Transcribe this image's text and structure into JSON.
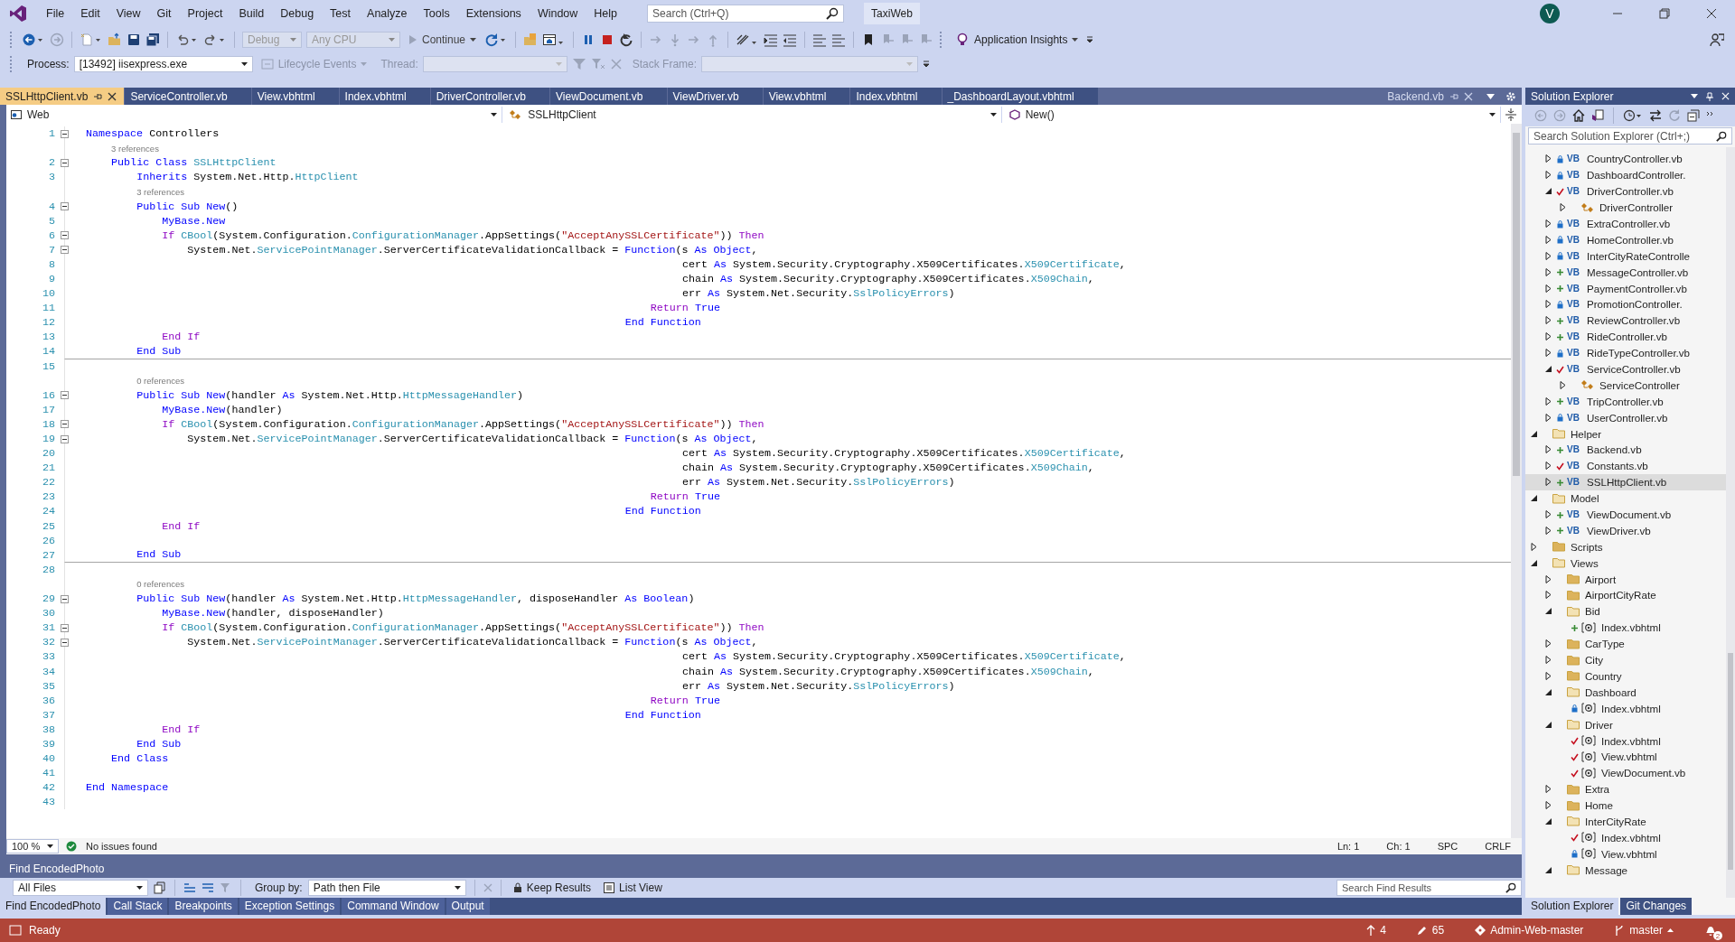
{
  "window": {
    "title": "TaxiWeb",
    "avatar": "V"
  },
  "menu": [
    "File",
    "Edit",
    "View",
    "Git",
    "Project",
    "Build",
    "Debug",
    "Test",
    "Analyze",
    "Tools",
    "Extensions",
    "Window",
    "Help"
  ],
  "search": {
    "placeholder": "Search (Ctrl+Q)"
  },
  "toolbar": {
    "configuration": {
      "label": "Debug",
      "disabled": true
    },
    "platform": {
      "label": "Any CPU",
      "disabled": true
    },
    "continue": "Continue",
    "insights": "Application Insights"
  },
  "debug_bar": {
    "process_label": "Process:",
    "process": "[13492] iisexpress.exe",
    "lifecycle": {
      "label": "Lifecycle Events",
      "disabled": true
    },
    "thread": {
      "label": "Thread:",
      "disabled": true
    },
    "stack_frame": {
      "label": "Stack Frame:",
      "disabled": true
    }
  },
  "tabs": [
    {
      "label": "SSLHttpClient.vb",
      "kind": "document",
      "selected": true
    },
    {
      "label": "ServiceController.vb",
      "kind": "document",
      "selected": false
    },
    {
      "label": "View.vbhtml",
      "kind": "document",
      "selected": false
    },
    {
      "label": "Index.vbhtml",
      "kind": "document",
      "selected": false
    },
    {
      "label": "DriverController.vb",
      "kind": "document",
      "selected": false
    },
    {
      "label": "ViewDocument.vb",
      "kind": "document",
      "selected": false
    },
    {
      "label": "ViewDriver.vb",
      "kind": "document",
      "selected": false
    },
    {
      "label": "View.vbhtml",
      "kind": "document",
      "selected": false
    },
    {
      "label": "Index.vbhtml",
      "kind": "document",
      "selected": false
    },
    {
      "label": "_DashboardLayout.vbhtml",
      "kind": "document",
      "selected": false
    },
    {
      "label": "Backend.vb",
      "kind": "preview",
      "selected": false
    }
  ],
  "nav_bar": {
    "project": "Web",
    "type": "SSLHttpClient",
    "member": "New()"
  },
  "code_lines": [
    {
      "kind": "line",
      "number": "1",
      "tokens": [
        {
          "kind": "kw",
          "text": "Namespace"
        },
        {
          "kind": "text",
          "text": " Controllers"
        }
      ],
      "children": [
        {
          "kind": "lens",
          "text": "3 references"
        },
        {
          "kind": "line",
          "number": "2",
          "tokens": [
            {
              "kind": "kw",
              "text": "Public Class "
            },
            {
              "kind": "type",
              "text": "SSLHttpClient"
            }
          ],
          "children": [
            {
              "kind": "line",
              "number": "3",
              "tokens": [
                {
                  "kind": "kw",
                  "text": "Inherits"
                },
                {
                  "kind": "text",
                  "text": " System.Net.Http."
                },
                {
                  "kind": "type",
                  "text": "HttpClient"
                }
              ]
            },
            {
              "kind": "lens",
              "text": "3 references"
            },
            {
              "kind": "line",
              "number": "4",
              "tokens": [
                {
                  "kind": "kw",
                  "text": "Public Sub New"
                },
                {
                  "kind": "text",
                  "text": "()"
                }
              ],
              "children": [
                {
                  "kind": "line",
                  "number": "5",
                  "tokens": [
                    {
                      "kind": "kw",
                      "text": "MyBase.New"
                    }
                  ]
                },
                {
                  "kind": "line",
                  "number": "6",
                  "tokens": [
                    {
                      "kind": "ctl",
                      "text": "If "
                    },
                    {
                      "kind": "type",
                      "text": "CBool"
                    },
                    {
                      "kind": "text",
                      "text": "(System.Configuration."
                    },
                    {
                      "kind": "type",
                      "text": "ConfigurationManager"
                    },
                    {
                      "kind": "text",
                      "text": ".AppSettings("
                    },
                    {
                      "kind": "str",
                      "text": "\"AcceptAnySSLCertificate\""
                    },
                    {
                      "kind": "text",
                      "text": ")) "
                    },
                    {
                      "kind": "ctl",
                      "text": "Then"
                    }
                  ],
                  "children": [
                    {
                      "kind": "line",
                      "number": "7",
                      "tokens": [
                        {
                          "kind": "text",
                          "text": "System.Net."
                        },
                        {
                          "kind": "type",
                          "text": "ServicePointManager"
                        },
                        {
                          "kind": "text",
                          "text": ".ServerCertificateValidationCallback = "
                        },
                        {
                          "kind": "lambda",
                          "text": "Function"
                        },
                        {
                          "kind": "text",
                          "text": "(s "
                        },
                        {
                          "kind": "kw",
                          "text": "As Object"
                        },
                        {
                          "kind": "text",
                          "text": ","
                        }
                      ],
                      "children": [
                        {
                          "kind": "param",
                          "number": "8",
                          "tokens": [
                            {
                              "kind": "text",
                              "text": "cert "
                            },
                            {
                              "kind": "kw",
                              "text": "As"
                            },
                            {
                              "kind": "text",
                              "text": " System.Security.Cryptography.X509Certificates."
                            },
                            {
                              "kind": "type",
                              "text": "X509Certificate"
                            },
                            {
                              "kind": "text",
                              "text": ","
                            }
                          ]
                        },
                        {
                          "kind": "param",
                          "number": "9",
                          "tokens": [
                            {
                              "kind": "text",
                              "text": "chain "
                            },
                            {
                              "kind": "kw",
                              "text": "As"
                            },
                            {
                              "kind": "text",
                              "text": " System.Security.Cryptography.X509Certificates."
                            },
                            {
                              "kind": "type",
                              "text": "X509Chain"
                            },
                            {
                              "kind": "text",
                              "text": ","
                            }
                          ]
                        },
                        {
                          "kind": "param",
                          "number": "10",
                          "tokens": [
                            {
                              "kind": "text",
                              "text": "err "
                            },
                            {
                              "kind": "kw",
                              "text": "As"
                            },
                            {
                              "kind": "text",
                              "text": " System.Net.Security."
                            },
                            {
                              "kind": "type",
                              "text": "SslPolicyErrors"
                            },
                            {
                              "kind": "text",
                              "text": ")"
                            }
                          ]
                        },
                        {
                          "kind": "lambda_body",
                          "number": "11",
                          "tokens": [
                            {
                              "kind": "ctl",
                              "text": "Return "
                            },
                            {
                              "kind": "kw",
                              "text": "True"
                            }
                          ]
                        },
                        {
                          "kind": "lambda_end",
                          "number": "12",
                          "tokens": [
                            {
                              "kind": "kw",
                              "text": "End Function"
                            }
                          ]
                        }
                      ]
                    }
                  ],
                  "end": {
                    "kind": "line",
                    "number": "13",
                    "tokens": [
                      {
                        "kind": "ctl",
                        "text": "End If"
                      }
                    ]
                  }
                }
              ],
              "end": {
                "kind": "line",
                "number": "14",
                "separator": true,
                "tokens": [
                  {
                    "kind": "kw",
                    "text": "End Sub"
                  }
                ]
              }
            },
            {
              "kind": "line",
              "number": "15"
            },
            {
              "kind": "lens",
              "text": "0 references"
            },
            {
              "kind": "line",
              "number": "16",
              "tokens": [
                {
                  "kind": "kw",
                  "text": "Public Sub New"
                },
                {
                  "kind": "text",
                  "text": "(handler "
                },
                {
                  "kind": "kw",
                  "text": "As"
                },
                {
                  "kind": "text",
                  "text": " System.Net.Http."
                },
                {
                  "kind": "type",
                  "text": "HttpMessageHandler"
                },
                {
                  "kind": "text",
                  "text": ")"
                }
              ],
              "children": [
                {
                  "kind": "line",
                  "number": "17",
                  "tokens": [
                    {
                      "kind": "kw",
                      "text": "MyBase.New"
                    },
                    {
                      "kind": "text",
                      "text": "(handler)"
                    }
                  ]
                },
                {
                  "kind": "line",
                  "number": "18",
                  "tokens": [
                    {
                      "kind": "ctl",
                      "text": "If "
                    },
                    {
                      "kind": "type",
                      "text": "CBool"
                    },
                    {
                      "kind": "text",
                      "text": "(System.Configuration."
                    },
                    {
                      "kind": "type",
                      "text": "ConfigurationManager"
                    },
                    {
                      "kind": "text",
                      "text": ".AppSettings("
                    },
                    {
                      "kind": "str",
                      "text": "\"AcceptAnySSLCertificate\""
                    },
                    {
                      "kind": "text",
                      "text": ")) "
                    },
                    {
                      "kind": "ctl",
                      "text": "Then"
                    }
                  ],
                  "children": [
                    {
                      "kind": "line",
                      "number": "19",
                      "tokens": [
                        {
                          "kind": "text",
                          "text": "System.Net."
                        },
                        {
                          "kind": "type",
                          "text": "ServicePointManager"
                        },
                        {
                          "kind": "text",
                          "text": ".ServerCertificateValidationCallback = "
                        },
                        {
                          "kind": "lambda",
                          "text": "Function"
                        },
                        {
                          "kind": "text",
                          "text": "(s "
                        },
                        {
                          "kind": "kw",
                          "text": "As Object"
                        },
                        {
                          "kind": "text",
                          "text": ","
                        }
                      ],
                      "children": [
                        {
                          "kind": "param",
                          "number": "20",
                          "tokens": [
                            {
                              "kind": "text",
                              "text": "cert "
                            },
                            {
                              "kind": "kw",
                              "text": "As"
                            },
                            {
                              "kind": "text",
                              "text": " System.Security.Cryptography.X509Certificates."
                            },
                            {
                              "kind": "type",
                              "text": "X509Certificate"
                            },
                            {
                              "kind": "text",
                              "text": ","
                            }
                          ]
                        },
                        {
                          "kind": "param",
                          "number": "21",
                          "tokens": [
                            {
                              "kind": "text",
                              "text": "chain "
                            },
                            {
                              "kind": "kw",
                              "text": "As"
                            },
                            {
                              "kind": "text",
                              "text": " System.Security.Cryptography.X509Certificates."
                            },
                            {
                              "kind": "type",
                              "text": "X509Chain"
                            },
                            {
                              "kind": "text",
                              "text": ","
                            }
                          ]
                        },
                        {
                          "kind": "param",
                          "number": "22",
                          "tokens": [
                            {
                              "kind": "text",
                              "text": "err "
                            },
                            {
                              "kind": "kw",
                              "text": "As"
                            },
                            {
                              "kind": "text",
                              "text": " System.Net.Security."
                            },
                            {
                              "kind": "type",
                              "text": "SslPolicyErrors"
                            },
                            {
                              "kind": "text",
                              "text": ")"
                            }
                          ]
                        },
                        {
                          "kind": "lambda_body",
                          "number": "23",
                          "tokens": [
                            {
                              "kind": "ctl",
                              "text": "Return "
                            },
                            {
                              "kind": "kw",
                              "text": "True"
                            }
                          ]
                        },
                        {
                          "kind": "lambda_end",
                          "number": "24",
                          "tokens": [
                            {
                              "kind": "kw",
                              "text": "End Function"
                            }
                          ]
                        }
                      ]
                    }
                  ],
                  "end": {
                    "kind": "line",
                    "number": "25",
                    "tokens": [
                      {
                        "kind": "ctl",
                        "text": "End If"
                      }
                    ]
                  }
                },
                {
                  "kind": "line",
                  "number": "26"
                }
              ],
              "end": {
                "kind": "line",
                "number": "27",
                "separator": true,
                "tokens": [
                  {
                    "kind": "kw",
                    "text": "End Sub"
                  }
                ]
              }
            },
            {
              "kind": "line",
              "number": "28"
            },
            {
              "kind": "lens",
              "text": "0 references"
            },
            {
              "kind": "line",
              "number": "29",
              "tokens": [
                {
                  "kind": "kw",
                  "text": "Public Sub New"
                },
                {
                  "kind": "text",
                  "text": "(handler "
                },
                {
                  "kind": "kw",
                  "text": "As"
                },
                {
                  "kind": "text",
                  "text": " System.Net.Http."
                },
                {
                  "kind": "type",
                  "text": "HttpMessageHandler"
                },
                {
                  "kind": "text",
                  "text": ", disposeHandler "
                },
                {
                  "kind": "kw",
                  "text": "As Boolean"
                },
                {
                  "kind": "text",
                  "text": ")"
                }
              ],
              "children": [
                {
                  "kind": "line",
                  "number": "30",
                  "tokens": [
                    {
                      "kind": "kw",
                      "text": "MyBase.New"
                    },
                    {
                      "kind": "text",
                      "text": "(handler, disposeHandler)"
                    }
                  ]
                },
                {
                  "kind": "line",
                  "number": "31",
                  "tokens": [
                    {
                      "kind": "ctl",
                      "text": "If "
                    },
                    {
                      "kind": "type",
                      "text": "CBool"
                    },
                    {
                      "kind": "text",
                      "text": "(System.Configuration."
                    },
                    {
                      "kind": "type",
                      "text": "ConfigurationManager"
                    },
                    {
                      "kind": "text",
                      "text": ".AppSettings("
                    },
                    {
                      "kind": "str",
                      "text": "\"AcceptAnySSLCertificate\""
                    },
                    {
                      "kind": "text",
                      "text": ")) "
                    },
                    {
                      "kind": "ctl",
                      "text": "Then"
                    }
                  ],
                  "children": [
                    {
                      "kind": "line",
                      "number": "32",
                      "tokens": [
                        {
                          "kind": "text",
                          "text": "System.Net."
                        },
                        {
                          "kind": "type",
                          "text": "ServicePointManager"
                        },
                        {
                          "kind": "text",
                          "text": ".ServerCertificateValidationCallback = "
                        },
                        {
                          "kind": "lambda",
                          "text": "Function"
                        },
                        {
                          "kind": "text",
                          "text": "(s "
                        },
                        {
                          "kind": "kw",
                          "text": "As Object"
                        },
                        {
                          "kind": "text",
                          "text": ","
                        }
                      ],
                      "children": [
                        {
                          "kind": "param",
                          "number": "33",
                          "tokens": [
                            {
                              "kind": "text",
                              "text": "cert "
                            },
                            {
                              "kind": "kw",
                              "text": "As"
                            },
                            {
                              "kind": "text",
                              "text": " System.Security.Cryptography.X509Certificates."
                            },
                            {
                              "kind": "type",
                              "text": "X509Certificate"
                            },
                            {
                              "kind": "text",
                              "text": ","
                            }
                          ]
                        },
                        {
                          "kind": "param",
                          "number": "34",
                          "tokens": [
                            {
                              "kind": "text",
                              "text": "chain "
                            },
                            {
                              "kind": "kw",
                              "text": "As"
                            },
                            {
                              "kind": "text",
                              "text": " System.Security.Cryptography.X509Certificates."
                            },
                            {
                              "kind": "type",
                              "text": "X509Chain"
                            },
                            {
                              "kind": "text",
                              "text": ","
                            }
                          ]
                        },
                        {
                          "kind": "param",
                          "number": "35",
                          "tokens": [
                            {
                              "kind": "text",
                              "text": "err "
                            },
                            {
                              "kind": "kw",
                              "text": "As"
                            },
                            {
                              "kind": "text",
                              "text": " System.Net.Security."
                            },
                            {
                              "kind": "type",
                              "text": "SslPolicyErrors"
                            },
                            {
                              "kind": "text",
                              "text": ")"
                            }
                          ]
                        },
                        {
                          "kind": "lambda_body",
                          "number": "36",
                          "tokens": [
                            {
                              "kind": "ctl",
                              "text": "Return "
                            },
                            {
                              "kind": "kw",
                              "text": "True"
                            }
                          ]
                        },
                        {
                          "kind": "lambda_end",
                          "number": "37",
                          "tokens": [
                            {
                              "kind": "kw",
                              "text": "End Function"
                            }
                          ]
                        }
                      ]
                    }
                  ],
                  "end": {
                    "kind": "line",
                    "number": "38",
                    "tokens": [
                      {
                        "kind": "ctl",
                        "text": "End If"
                      }
                    ]
                  }
                }
              ],
              "end": {
                "kind": "line",
                "number": "39",
                "separator": false,
                "tokens": [
                  {
                    "kind": "kw",
                    "text": "End Sub"
                  }
                ]
              }
            }
          ],
          "end": {
            "kind": "line",
            "number": "40",
            "tokens": [
              {
                "kind": "kw",
                "text": "End Class"
              }
            ]
          }
        },
        {
          "kind": "line",
          "number": "41"
        }
      ],
      "end": {
        "kind": "line",
        "number": "42",
        "tokens": [
          {
            "kind": "kw",
            "text": "End Namespace"
          }
        ]
      }
    },
    {
      "kind": "line",
      "number": "43"
    }
  ],
  "editor_status": {
    "zoom": "100 %",
    "issues": "No issues found",
    "line": "Ln: 1",
    "column": "Ch: 1",
    "whitespace": "SPC",
    "line_ending": "CRLF"
  },
  "find_panel": {
    "title": "Find EncodedPhoto",
    "scope": "All Files",
    "group_by_label": "Group by:",
    "group_by": "Path then File",
    "keep_results": "Keep Results",
    "list_view": "List View",
    "search_placeholder": "Search Find Results"
  },
  "bottom_tabs": [
    {
      "label": "Find EncodedPhoto",
      "selected": true
    },
    {
      "label": "Call Stack",
      "selected": false
    },
    {
      "label": "Breakpoints",
      "selected": false
    },
    {
      "label": "Exception Settings",
      "selected": false
    },
    {
      "label": "Command Window",
      "selected": false
    },
    {
      "label": "Output",
      "selected": false
    }
  ],
  "solution_explorer": {
    "title": "Solution Explorer",
    "search_placeholder": "Search Solution Explorer (Ctrl+;)",
    "items": [
      {
        "children": [
          {
            "label": "CountryController.vb",
            "kind": "vb",
            "badge": "VB",
            "added": false,
            "modified": false,
            "expanded": false,
            "selected": false
          },
          {
            "label": "DashboardController.",
            "kind": "vb",
            "badge": "VB",
            "added": false,
            "modified": false,
            "expanded": false,
            "selected": false
          },
          {
            "label": "DriverController.vb",
            "kind": "vb",
            "badge": "VB",
            "added": false,
            "modified": true,
            "expanded": true,
            "selected": false,
            "children": [
              {
                "label": "DriverController",
                "kind": "class",
                "expanded": false,
                "selected": false
              }
            ]
          },
          {
            "label": "ExtraController.vb",
            "kind": "vb",
            "badge": "VB",
            "added": false,
            "modified": false,
            "expanded": false,
            "selected": false
          },
          {
            "label": "HomeController.vb",
            "kind": "vb",
            "badge": "VB",
            "added": false,
            "modified": false,
            "expanded": false,
            "selected": false
          },
          {
            "label": "InterCityRateControlle",
            "kind": "vb",
            "badge": "VB",
            "added": false,
            "modified": false,
            "expanded": false,
            "selected": false
          },
          {
            "label": "MessageController.vb",
            "kind": "vb",
            "badge": "VB",
            "added": true,
            "modified": false,
            "expanded": false,
            "selected": false
          },
          {
            "label": "PaymentController.vb",
            "kind": "vb",
            "badge": "VB",
            "added": true,
            "modified": false,
            "expanded": false,
            "selected": false
          },
          {
            "label": "PromotionController.",
            "kind": "vb",
            "badge": "VB",
            "added": false,
            "modified": false,
            "expanded": false,
            "selected": false
          },
          {
            "label": "ReviewController.vb",
            "kind": "vb",
            "badge": "VB",
            "added": true,
            "modified": false,
            "expanded": false,
            "selected": false
          },
          {
            "label": "RideController.vb",
            "kind": "vb",
            "badge": "VB",
            "added": true,
            "modified": false,
            "expanded": false,
            "selected": false
          },
          {
            "label": "RideTypeController.vb",
            "kind": "vb",
            "badge": "VB",
            "added": false,
            "modified": false,
            "expanded": false,
            "selected": false
          },
          {
            "label": "ServiceController.vb",
            "kind": "vb",
            "badge": "VB",
            "added": false,
            "modified": true,
            "expanded": true,
            "selected": false,
            "children": [
              {
                "label": "ServiceController",
                "kind": "class",
                "expanded": false,
                "selected": false
              }
            ]
          },
          {
            "label": "TripController.vb",
            "kind": "vb",
            "badge": "VB",
            "added": true,
            "modified": false,
            "expanded": false,
            "selected": false
          },
          {
            "label": "UserController.vb",
            "kind": "vb",
            "badge": "VB",
            "added": false,
            "modified": false,
            "expanded": false,
            "selected": false
          }
        ]
      },
      {
        "label": "Helper",
        "kind": "folder",
        "expanded": true,
        "selected": false,
        "children": [
          {
            "label": "Backend.vb",
            "kind": "vb",
            "badge": "VB",
            "added": true,
            "modified": false,
            "expanded": false,
            "selected": false
          },
          {
            "label": "Constants.vb",
            "kind": "vb",
            "badge": "VB",
            "added": false,
            "modified": true,
            "expanded": false,
            "selected": false
          },
          {
            "label": "SSLHttpClient.vb",
            "kind": "vb",
            "badge": "VB",
            "added": true,
            "modified": false,
            "expanded": false,
            "selected": true
          }
        ]
      },
      {
        "label": "Model",
        "kind": "folder",
        "expanded": true,
        "selected": false,
        "children": [
          {
            "label": "ViewDocument.vb",
            "kind": "vb",
            "badge": "VB",
            "added": true,
            "modified": false,
            "expanded": false,
            "selected": false
          },
          {
            "label": "ViewDriver.vb",
            "kind": "vb",
            "badge": "VB",
            "added": true,
            "modified": false,
            "expanded": false,
            "selected": false
          }
        ]
      },
      {
        "label": "Scripts",
        "kind": "folder",
        "expanded": false,
        "selected": false
      },
      {
        "label": "Views",
        "kind": "folder",
        "expanded": true,
        "selected": false,
        "children": [
          {
            "label": "Airport",
            "kind": "folder",
            "expanded": false,
            "selected": false
          },
          {
            "label": "AirportCityRate",
            "kind": "folder",
            "expanded": false,
            "selected": false
          },
          {
            "label": "Bid",
            "kind": "folder",
            "expanded": true,
            "selected": false,
            "children": [
              {
                "label": "Index.vbhtml",
                "kind": "razor",
                "added": true,
                "modified": false,
                "selected": false
              }
            ]
          },
          {
            "label": "CarType",
            "kind": "folder",
            "expanded": false,
            "selected": false
          },
          {
            "label": "City",
            "kind": "folder",
            "expanded": false,
            "selected": false
          },
          {
            "label": "Country",
            "kind": "folder",
            "expanded": false,
            "selected": false
          },
          {
            "label": "Dashboard",
            "kind": "folder",
            "expanded": true,
            "selected": false,
            "children": [
              {
                "label": "Index.vbhtml",
                "kind": "razor",
                "added": false,
                "modified": false,
                "selected": false
              }
            ]
          },
          {
            "label": "Driver",
            "kind": "folder",
            "expanded": true,
            "selected": false,
            "children": [
              {
                "label": "Index.vbhtml",
                "kind": "razor",
                "added": false,
                "modified": true,
                "selected": false
              },
              {
                "label": "View.vbhtml",
                "kind": "razor",
                "added": false,
                "modified": true,
                "selected": false
              },
              {
                "label": "ViewDocument.vb",
                "kind": "razor",
                "added": false,
                "modified": true,
                "selected": false
              }
            ]
          },
          {
            "label": "Extra",
            "kind": "folder",
            "expanded": false,
            "selected": false
          },
          {
            "label": "Home",
            "kind": "folder",
            "expanded": false,
            "selected": false
          },
          {
            "label": "InterCityRate",
            "kind": "folder",
            "expanded": true,
            "selected": false,
            "children": [
              {
                "label": "Index.vbhtml",
                "kind": "razor",
                "added": false,
                "modified": true,
                "selected": false
              },
              {
                "label": "View.vbhtml",
                "kind": "razor",
                "added": false,
                "modified": false,
                "selected": false
              }
            ]
          },
          {
            "label": "Message",
            "kind": "folder",
            "expanded": true,
            "selected": false
          }
        ]
      }
    ]
  },
  "side_tabs": [
    {
      "label": "Solution Explorer",
      "selected": true
    },
    {
      "label": "Git Changes",
      "selected": false
    }
  ],
  "status_bar": {
    "state": "Ready",
    "pushes": "4",
    "changes": "65",
    "repository": "Admin-Web-master",
    "branch": "master",
    "notifications": "2"
  }
}
